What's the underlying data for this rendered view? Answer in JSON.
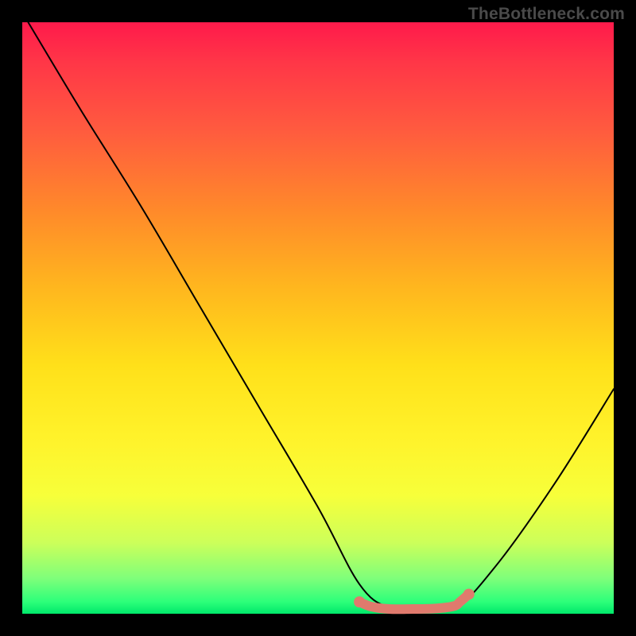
{
  "watermark": "TheBottleneck.com",
  "chart_data": {
    "type": "line",
    "title": "",
    "xlabel": "",
    "ylabel": "",
    "xlim": [
      0,
      100
    ],
    "ylim": [
      0,
      100
    ],
    "grid": false,
    "series": [
      {
        "name": "curve",
        "color": "#000000",
        "x": [
          1,
          10,
          20,
          30,
          40,
          50,
          57,
          62,
          66,
          73,
          80,
          90,
          100
        ],
        "y": [
          100,
          85,
          69,
          52,
          35,
          18,
          5,
          1,
          1,
          1,
          8,
          22,
          38
        ]
      },
      {
        "name": "optimal-range",
        "color": "#e07a6d",
        "x": [
          57,
          59,
          62,
          66,
          70,
          73,
          74,
          75.5
        ],
        "y": [
          2.0,
          1.2,
          0.8,
          0.8,
          0.9,
          1.3,
          2.0,
          3.3
        ]
      }
    ],
    "annotations": []
  }
}
